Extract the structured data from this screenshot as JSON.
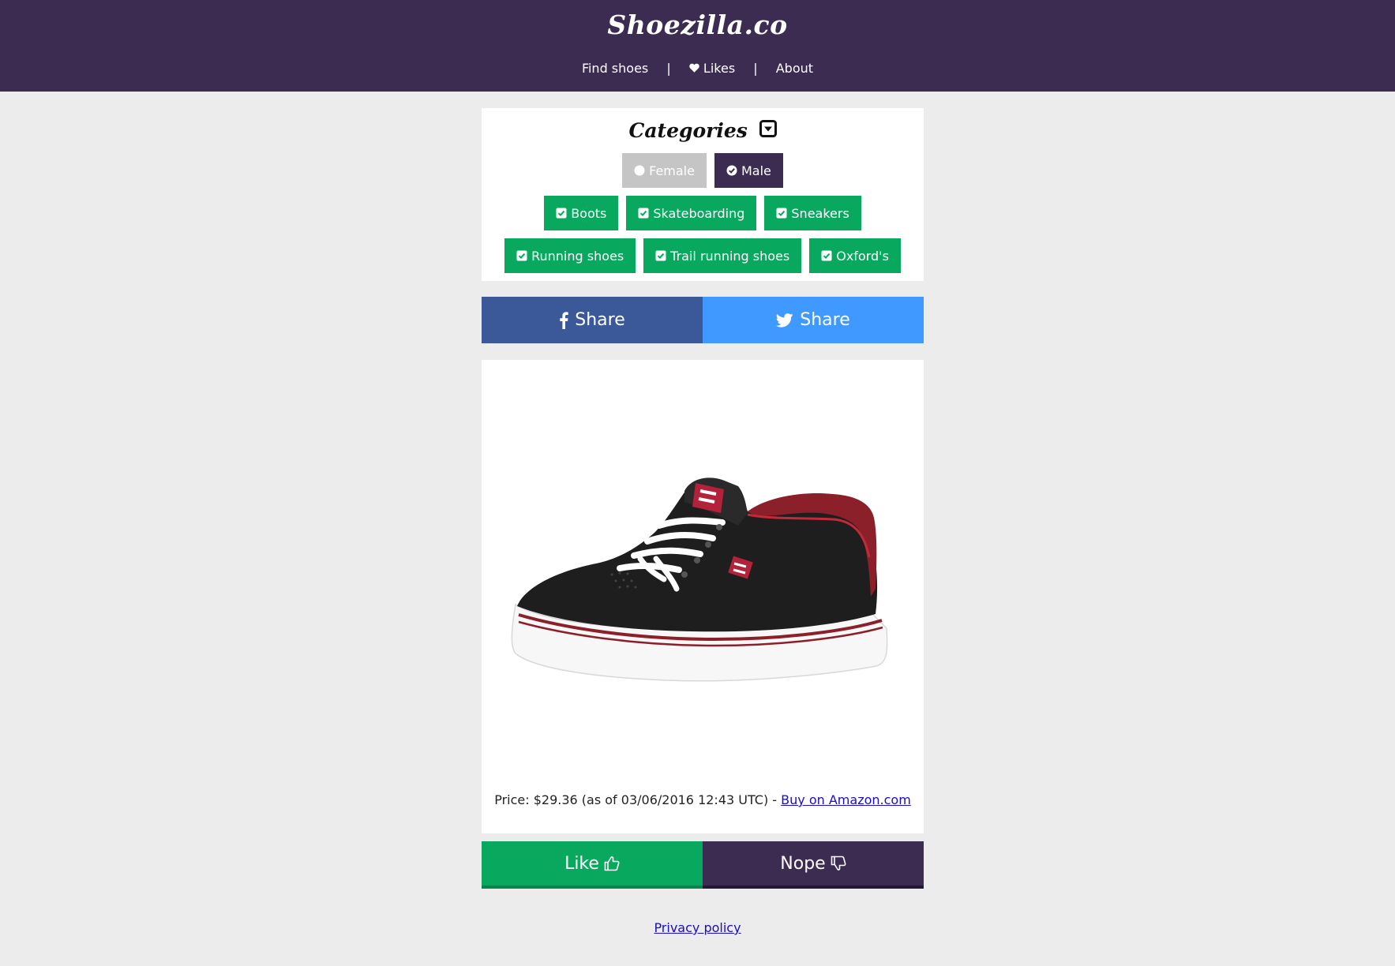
{
  "header": {
    "logo": "Shoezilla.co",
    "nav": [
      {
        "label": "Find shoes"
      },
      {
        "label": "Likes",
        "icon": "heart-icon"
      },
      {
        "label": "About"
      }
    ],
    "separator": "|"
  },
  "categories": {
    "title": "Categories",
    "toggle_icon": "caret-down-square-icon",
    "gender": [
      {
        "label": "Female",
        "state": "unselected",
        "icon": "circle-icon"
      },
      {
        "label": "Male",
        "state": "selected",
        "icon": "check-circle-icon"
      }
    ],
    "types": [
      {
        "label": "Boots",
        "checked": true
      },
      {
        "label": "Skateboarding",
        "checked": true
      },
      {
        "label": "Sneakers",
        "checked": true
      },
      {
        "label": "Running shoes",
        "checked": true
      },
      {
        "label": "Trail running shoes",
        "checked": true
      },
      {
        "label": "Oxford's",
        "checked": true
      }
    ]
  },
  "share": {
    "facebook_label": "Share",
    "twitter_label": "Share"
  },
  "product": {
    "price_text": "Price: $29.36 (as of 03/06/2016 12:43 UTC) -",
    "buy_link": "Buy on Amazon.com"
  },
  "vote": {
    "like_label": "Like",
    "nope_label": "Nope"
  },
  "footer": {
    "privacy_link": "Privacy policy"
  },
  "colors": {
    "header_bg": "#3c2c52",
    "page_bg": "#ececec",
    "green": "#08a95f",
    "facebook": "#3b5998",
    "twitter": "#4099ff",
    "chip_off": "#c5c5c5",
    "link": "#1a0dcc"
  }
}
